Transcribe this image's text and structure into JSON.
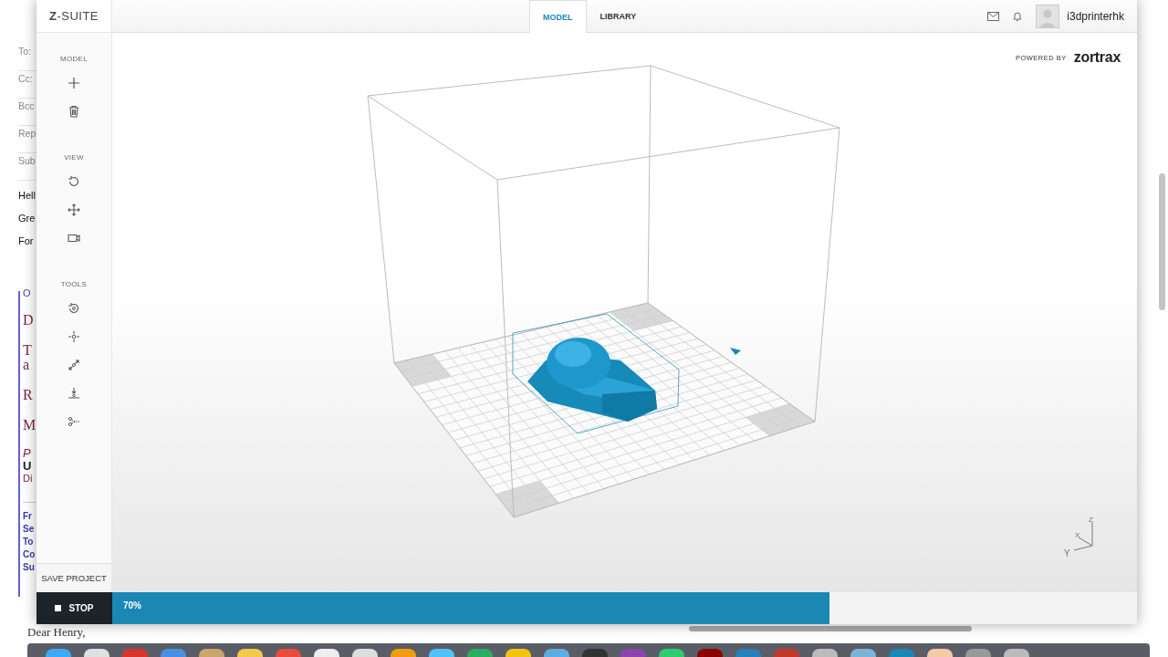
{
  "mail": {
    "headers": [
      "To:",
      "Cc:",
      "Bcc",
      "Rep",
      "Sub"
    ],
    "greeting": [
      "Hell",
      "Gre",
      "For"
    ],
    "quote": [
      {
        "text": "O",
        "kind": "link"
      },
      {
        "text": "D",
        "kind": "serif"
      },
      {
        "text": "T",
        "kind": "serif"
      },
      {
        "text": "a",
        "kind": "serif-tight"
      },
      {
        "text": "R",
        "kind": "serif"
      },
      {
        "text": "M",
        "kind": "serif"
      },
      {
        "text": "P",
        "kind": "italic"
      },
      {
        "text": "U",
        "kind": "bold"
      },
      {
        "text": "Di",
        "kind": "small"
      },
      {
        "text": "Fr",
        "kind": "label-first"
      },
      {
        "text": "Se",
        "kind": "label"
      },
      {
        "text": "To",
        "kind": "label"
      },
      {
        "text": "Co",
        "kind": "label"
      },
      {
        "text": "Su",
        "kind": "label"
      }
    ],
    "closing": "Dear Henry,"
  },
  "app": {
    "logo": "**Z**-SUITE",
    "tabs": [
      {
        "label": "MODEL",
        "selected": true
      },
      {
        "label": "LIBRARY",
        "selected": false
      }
    ],
    "username": "i3dprinterhk",
    "powered_by": "POWERED BY",
    "brand": "zortrax",
    "sidebar": {
      "sections": [
        {
          "title": "MODEL"
        },
        {
          "title": "VIEW"
        },
        {
          "title": "TOOLS"
        }
      ],
      "save": "SAVE PROJECT"
    },
    "stop": "STOP",
    "progress": {
      "level": 0.7,
      "reading": "70%"
    },
    "axes": {
      "x": "X",
      "y": "Y",
      "z": "Z"
    }
  }
}
